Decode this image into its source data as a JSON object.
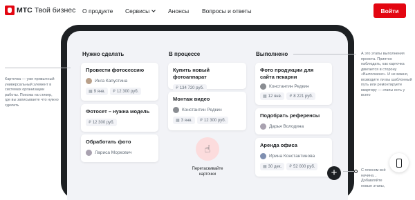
{
  "header": {
    "brand": "МТС",
    "product": "Твой бизнес",
    "nav": [
      "О продукте",
      "Сервисы",
      "Анонсы",
      "Вопросы и ответы"
    ],
    "login_label": "Войти"
  },
  "board": {
    "columns": [
      {
        "title": "Нужно сделать",
        "cards": [
          {
            "title": "Провести фотосессию",
            "person": "Инга Капустина",
            "tags": [
              "9 янв.",
              "12 300 руб."
            ]
          },
          {
            "title": "Фотосет – нужна модель",
            "tags": [
              "12 300 руб."
            ]
          },
          {
            "title": "Обработать фото",
            "person": "Лариса Моркович"
          }
        ]
      },
      {
        "title": "В процессе",
        "cards": [
          {
            "title": "Купить новый фотоаппарат",
            "tags": [
              "134 720 руб."
            ]
          },
          {
            "title": "Монтаж видео",
            "person": "Константин Редкин",
            "tags": [
              "3 янв.",
              "12 300 руб."
            ]
          }
        ]
      },
      {
        "title": "Выполнено",
        "cards": [
          {
            "title": "Фото продукции для сайта пекарни",
            "person": "Константин Редкин",
            "tags": [
              "12 янв.",
              "8 221 руб."
            ]
          },
          {
            "title": "Подобрать референсы",
            "person": "Дарья Володина"
          },
          {
            "title": "Аренда офиса",
            "person": "Ирина Константинова",
            "tags": [
              "30 дек.",
              "52 000 руб."
            ]
          }
        ]
      }
    ],
    "drag_hint": "Перетаскивайте карточки",
    "add_label": "+"
  },
  "annotations": {
    "left": "Карточка — уже привычный универсальный элемент в системах организации работы. Похожа на стикер, где вы записываете что нужно сделать",
    "right_top": "А это этапы выполнения проекта. Приятно наблюдать, как карточка двигается в сторону «Выполнено». И не важно, возводите ли вы шаблонный путь или ремонтируете квартиру — этапы есть у всего",
    "right_bottom": "С плюсом всё начина... Добавляйте новые этапы, задачи, клиентов — в общем, плюсуйте"
  },
  "colors": {
    "accent": "#e30611",
    "dark": "#1d2023",
    "board_bg": "#f2f3f7",
    "drag_bg": "#fcdcdd"
  }
}
